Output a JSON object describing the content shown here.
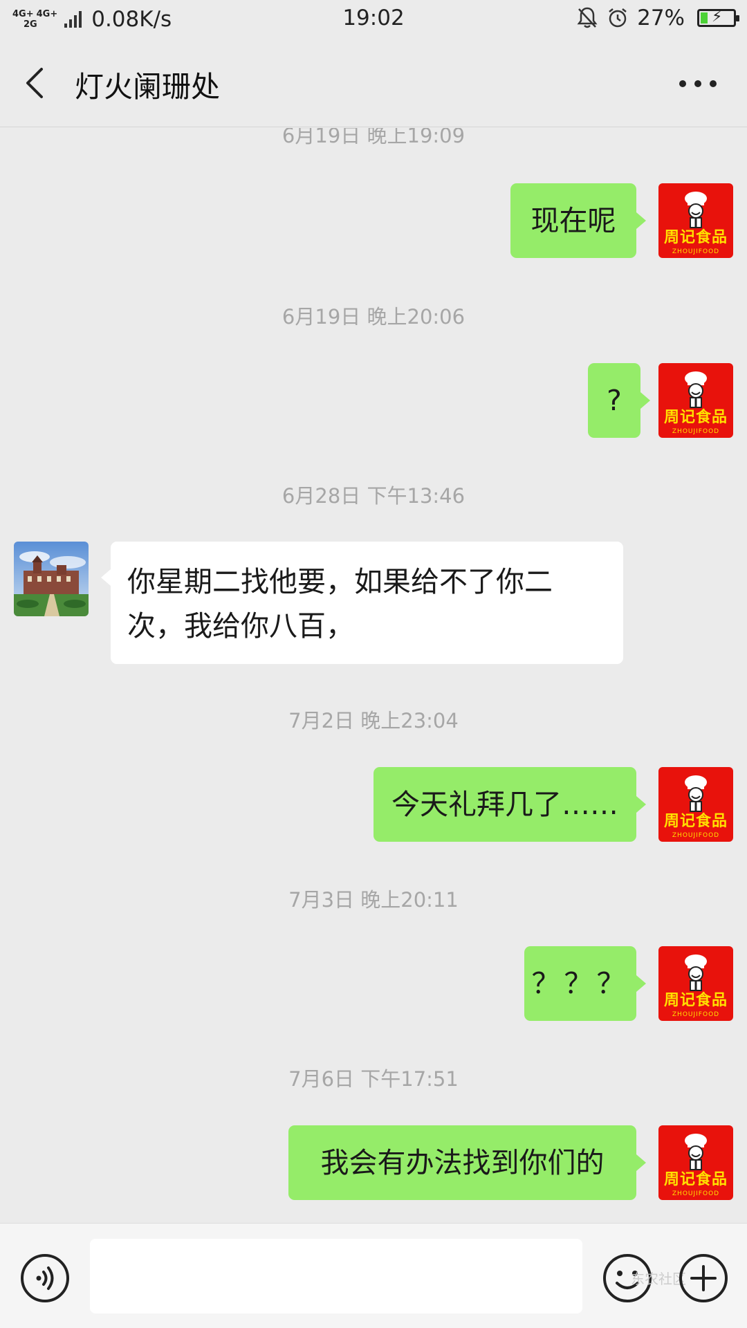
{
  "status_bar": {
    "net_types": [
      "4G+",
      "4G+",
      "2G"
    ],
    "speed": "0.08K/s",
    "time": "19:02",
    "battery_percent": "27%",
    "battery_level": 0.27
  },
  "header": {
    "title": "灯火阑珊处"
  },
  "avatars": {
    "self_brand": "周记食品",
    "self_brand_en": "ZHOUJIFOOD"
  },
  "messages": [
    {
      "kind": "timestamp",
      "text": "6月19日 晚上19:09"
    },
    {
      "kind": "out",
      "text": "现在呢"
    },
    {
      "kind": "timestamp",
      "text": "6月19日 晚上20:06"
    },
    {
      "kind": "out",
      "text": "?"
    },
    {
      "kind": "timestamp",
      "text": "6月28日 下午13:46"
    },
    {
      "kind": "in",
      "text": "你星期二找他要，如果给不了你二次，我给你八百，"
    },
    {
      "kind": "timestamp",
      "text": "7月2日 晚上23:04"
    },
    {
      "kind": "out",
      "text": "今天礼拜几了……"
    },
    {
      "kind": "timestamp",
      "text": "7月3日 晚上20:11"
    },
    {
      "kind": "out",
      "text": "？？？"
    },
    {
      "kind": "timestamp",
      "text": "7月6日 下午17:51"
    },
    {
      "kind": "out",
      "text": "我会有办法找到你们的"
    }
  ],
  "input": {
    "value": "",
    "placeholder": ""
  },
  "watermark": "东农社区"
}
